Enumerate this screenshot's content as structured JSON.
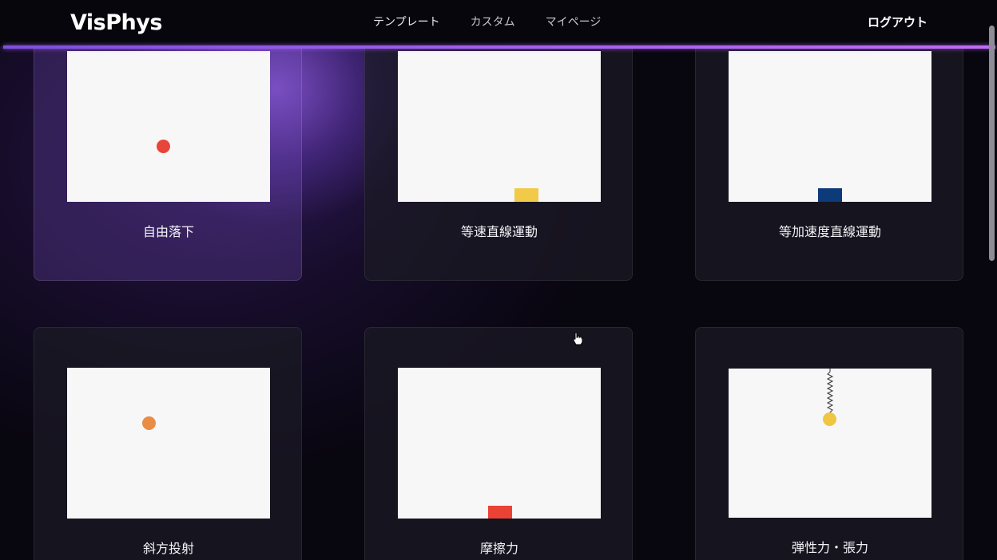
{
  "app": {
    "title": "VisPhys"
  },
  "nav": {
    "links": [
      "テンプレート",
      "カスタム",
      "マイページ"
    ],
    "logout": "ログアウト"
  },
  "colors": {
    "accent_line": "#a35ef0",
    "red_ball": "#e8453a",
    "yellow_block": "#f1ca47",
    "navy_block": "#0d3a78",
    "orange_ball": "#e98c45",
    "red_block": "#ea4336",
    "yellow_bob": "#f0c640"
  },
  "templates": [
    {
      "label": "自由落下",
      "object": "ball"
    },
    {
      "label": "等速直線運動",
      "object": "block"
    },
    {
      "label": "等加速度直線運動",
      "object": "block"
    },
    {
      "label": "斜方投射",
      "object": "ball"
    },
    {
      "label": "摩擦力",
      "object": "block"
    },
    {
      "label": "弾性力・張力",
      "object": "spring-pendulum"
    }
  ]
}
